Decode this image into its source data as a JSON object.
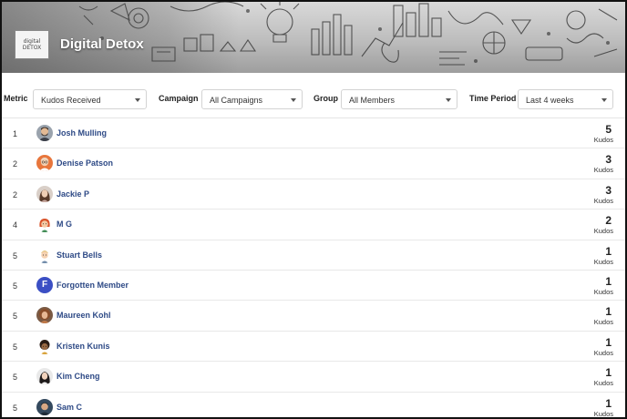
{
  "header": {
    "title": "Digital Detox",
    "logo_line1": "digital",
    "logo_line2": "DETOX"
  },
  "filters": {
    "metric_label": "Metric",
    "metric_value": "Kudos Received",
    "campaign_label": "Campaign",
    "campaign_value": "All Campaigns",
    "group_label": "Group",
    "group_value": "All Members",
    "period_label": "Time Period",
    "period_value": "Last 4 weeks"
  },
  "leaderboard": [
    {
      "rank": "1",
      "name": "Josh Mulling",
      "count": "5",
      "unit": "Kudos",
      "avatar": "man-beard-avatar"
    },
    {
      "rank": "2",
      "name": "Denise Patson",
      "count": "3",
      "unit": "Kudos",
      "avatar": "woman-glasses-avatar"
    },
    {
      "rank": "2",
      "name": "Jackie P",
      "count": "3",
      "unit": "Kudos",
      "avatar": "woman-portrait-avatar"
    },
    {
      "rank": "4",
      "name": "M G",
      "count": "2",
      "unit": "Kudos",
      "avatar": "cartoon-girl-avatar"
    },
    {
      "rank": "5",
      "name": "Stuart Bells",
      "count": "1",
      "unit": "Kudos",
      "avatar": "cartoon-boy-avatar"
    },
    {
      "rank": "5",
      "name": "Forgotten Member",
      "count": "1",
      "unit": "Kudos",
      "avatar": "letter-f-avatar",
      "initial": "F"
    },
    {
      "rank": "5",
      "name": "Maureen Kohl",
      "count": "1",
      "unit": "Kudos",
      "avatar": "woman-curly-avatar"
    },
    {
      "rank": "5",
      "name": "Kristen Kunis",
      "count": "1",
      "unit": "Kudos",
      "avatar": "cartoon-woman-avatar"
    },
    {
      "rank": "5",
      "name": "Kim Cheng",
      "count": "1",
      "unit": "Kudos",
      "avatar": "woman-dark-hair-avatar"
    },
    {
      "rank": "5",
      "name": "Sam C",
      "count": "1",
      "unit": "Kudos",
      "avatar": "man-dark-avatar"
    }
  ],
  "colors": {
    "name_link": "#2e4a86",
    "forgotten_avatar_bg": "#3b4fc4"
  }
}
